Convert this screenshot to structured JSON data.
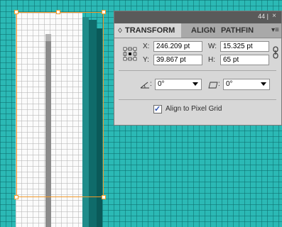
{
  "panel": {
    "title_bar_text": "44 |",
    "close_icon": "close-icon",
    "menu_icon": "panel-menu-icon",
    "tabs": [
      {
        "label": "TRANSFORM",
        "active": true
      },
      {
        "label": "ALIGN",
        "active": false
      },
      {
        "label": "PATHFIN",
        "active": false
      }
    ],
    "tab_transform_icon": "♢"
  },
  "transform": {
    "x_label": "X:",
    "x_value": "246.209 pt",
    "y_label": "Y:",
    "y_value": "39.867 pt",
    "w_label": "W:",
    "w_value": "15.325 pt",
    "h_label": "H:",
    "h_value": "65 pt",
    "rotate_colon": ":",
    "rotate_value": "0°",
    "shear_colon": ":",
    "shear_value": "0°",
    "align_to_pixel_grid_label": "Align to Pixel Grid",
    "align_to_pixel_grid_checked": true,
    "checkmark": "✓"
  },
  "colors": {
    "canvas": "#2bb9b5",
    "selection": "#f39a29",
    "panel_bg": "#d7d7d7",
    "titlebar": "#5a5a5a"
  }
}
